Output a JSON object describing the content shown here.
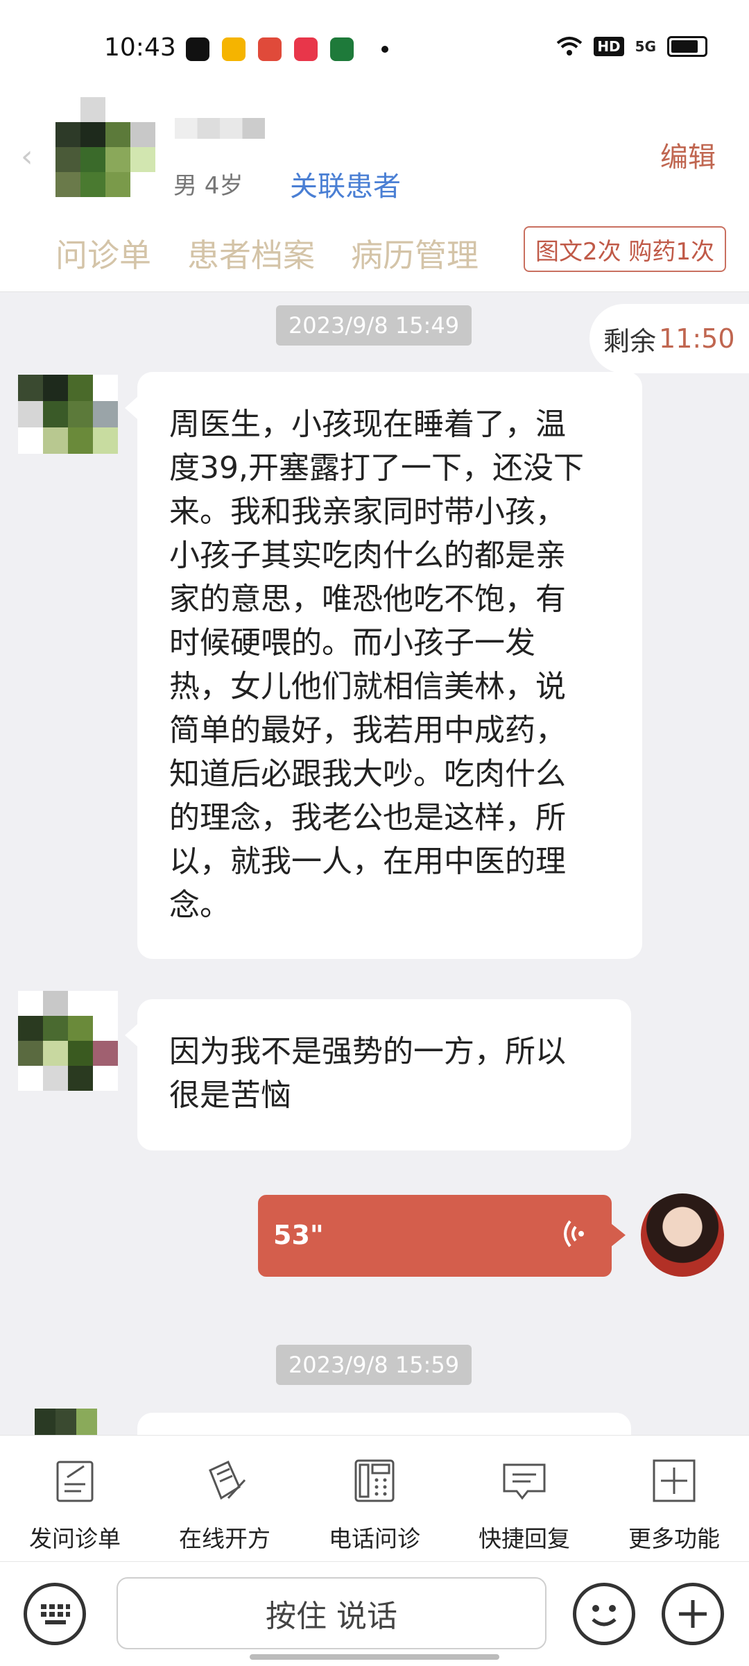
{
  "status_bar": {
    "time": "10:43",
    "network": "5G",
    "hd": "HD"
  },
  "header": {
    "patient_info": "男 4岁",
    "link_patient": "关联患者",
    "edit": "编辑",
    "tabs": [
      "问诊单",
      "患者档案",
      "病历管理"
    ],
    "stats_badge": "图文2次 购药1次"
  },
  "chat": {
    "remaining_label": "剩余",
    "remaining_time": "11:50",
    "timestamps": [
      "2023/9/8 15:49",
      "2023/9/8 15:59"
    ],
    "messages": [
      {
        "lines": [
          "周医生，小孩现在睡着了，温",
          "度39,开塞露打了一下，还没下",
          "来。我和我亲家同时带小孩，",
          "小孩子其实吃肉什么的都是亲",
          "家的意思，唯恐他吃不饱，有",
          "时候硬喂的。而小孩子一发",
          "热，女儿他们就相信美林，说",
          "简单的最好，我若用中成药，",
          "知道后必跟我大吵。吃肉什么",
          "的理念，我老公也是这样，所",
          "以，就我一人，在用中医的理",
          "念。"
        ]
      },
      {
        "lines": [
          "因为我不是强势的一方，所以",
          "很是苦恼"
        ]
      }
    ],
    "voice_duration": "53\""
  },
  "toolbar": {
    "items": [
      "发问诊单",
      "在线开方",
      "电话问诊",
      "快捷回复",
      "更多功能"
    ]
  },
  "input": {
    "press_to_talk": "按住 说话"
  },
  "colors": {
    "accent": "#c06650",
    "voice_bubble": "#d45e4c",
    "link": "#4a7fd4",
    "tab_text": "#d4c4a8"
  }
}
